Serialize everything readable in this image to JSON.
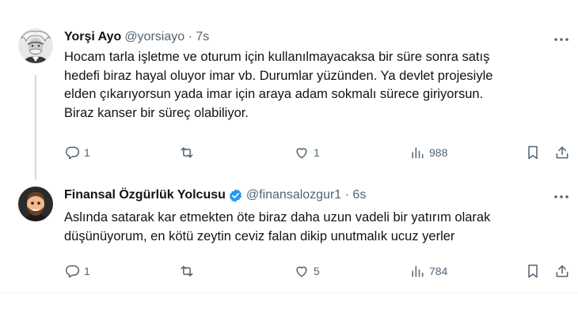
{
  "tweets": [
    {
      "name": "Yorşi Ayo",
      "handle": "@yorsiayo · 7s",
      "lines": [
        "Hocam tarla işletme ve oturum için kullanılmayacaksa bir süre sonra satış",
        "hedefi biraz hayal oluyor imar vb. Durumlar yüzünden. Ya devlet projesiyle",
        "elden çıkarıyorsun yada imar için araya adam sokmalı sürece giriyorsun.",
        "Biraz kanser bir süreç olabiliyor."
      ],
      "replies": "1",
      "retweets": "",
      "likes": "1",
      "views": "988"
    },
    {
      "name": "Finansal Özgürlük Yolcusu",
      "handle": "@finansalozgur1 · 6s",
      "verified": true,
      "lines": [
        "Aslında satarak kar etmekten öte biraz daha uzun vadeli bir yatırım olarak",
        "düşünüyorum, en kötü zeytin ceviz falan dikip unutmalık ucuz yerler"
      ],
      "replies": "1",
      "retweets": "",
      "likes": "5",
      "views": "784"
    }
  ],
  "colors": {
    "text": "#0f1419",
    "secondary": "#536471",
    "verified": "#1d9bf0",
    "thread_line": "#cfd9de"
  },
  "icons": [
    "reply-icon",
    "retweet-icon",
    "like-icon",
    "views-icon",
    "bookmark-icon",
    "share-icon",
    "more-icon",
    "verified-badge-icon"
  ]
}
